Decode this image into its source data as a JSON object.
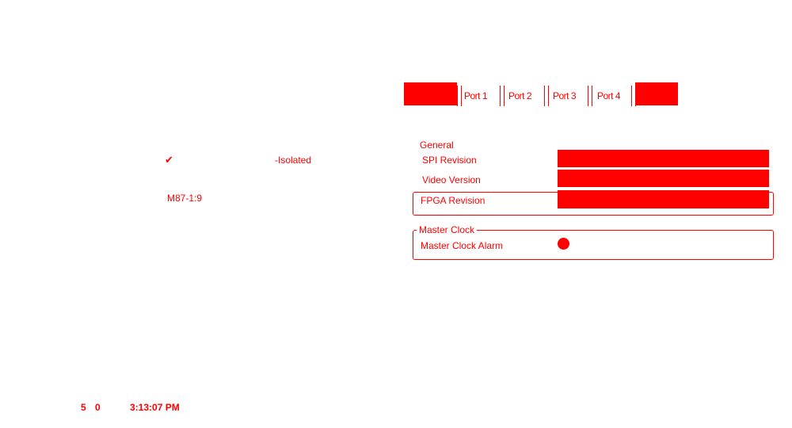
{
  "left": {
    "check_glyph": "✔",
    "status_text": "-Isolated",
    "id_text": "M87-1:9"
  },
  "footer": {
    "left_a": "5",
    "left_b": "0",
    "time": "3:13:07 PM"
  },
  "tabs": [
    {
      "label": ""
    },
    {
      "label": "Port 1"
    },
    {
      "label": "Port 2"
    },
    {
      "label": "Port 3"
    },
    {
      "label": "Port 4"
    },
    {
      "label": ""
    }
  ],
  "general": {
    "legend": "General",
    "rows": [
      {
        "label": "SPI Revision",
        "value": ""
      },
      {
        "label": "Video Version",
        "value": ""
      },
      {
        "label": "FPGA Revision",
        "value": ""
      }
    ]
  },
  "master_clock": {
    "legend": "Master Clock",
    "alarm_label": "Master Clock Alarm",
    "alarm_color": "#ff0000"
  },
  "colors": {
    "accent": "#ff0000",
    "background": "#ffffff"
  }
}
